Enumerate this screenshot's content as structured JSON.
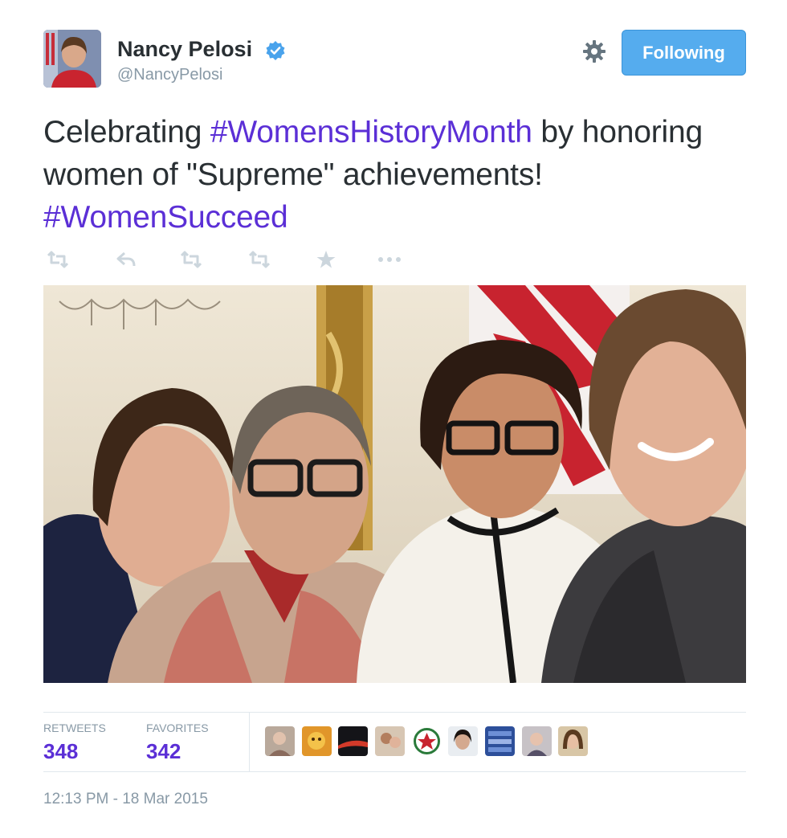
{
  "author": {
    "name": "Nancy Pelosi",
    "handle": "@NancyPelosi",
    "verified": true
  },
  "follow_button": {
    "label": "Following"
  },
  "tweet": {
    "text_parts": [
      {
        "text": "Celebrating ",
        "type": "text"
      },
      {
        "text": "#WomensHistoryMonth",
        "type": "hashtag"
      },
      {
        "text": " by honoring women of \"Supreme\" achievements! ",
        "type": "text"
      },
      {
        "text": "#WomenSucceed",
        "type": "hashtag"
      }
    ]
  },
  "actions": [
    "retweet-icon",
    "reply-icon",
    "retweet-icon",
    "retweet-icon",
    "favorite-icon",
    "more-icon"
  ],
  "stats": {
    "retweets_label": "RETWEETS",
    "retweets_value": "348",
    "favorites_label": "FAVORITES",
    "favorites_value": "342"
  },
  "favoriters_count_shown": 9,
  "timestamp": "12:13 PM - 18 Mar 2015",
  "colors": {
    "hashtag": "#5b2fd6",
    "follow_button": "#55acee",
    "muted": "#8899a6"
  }
}
